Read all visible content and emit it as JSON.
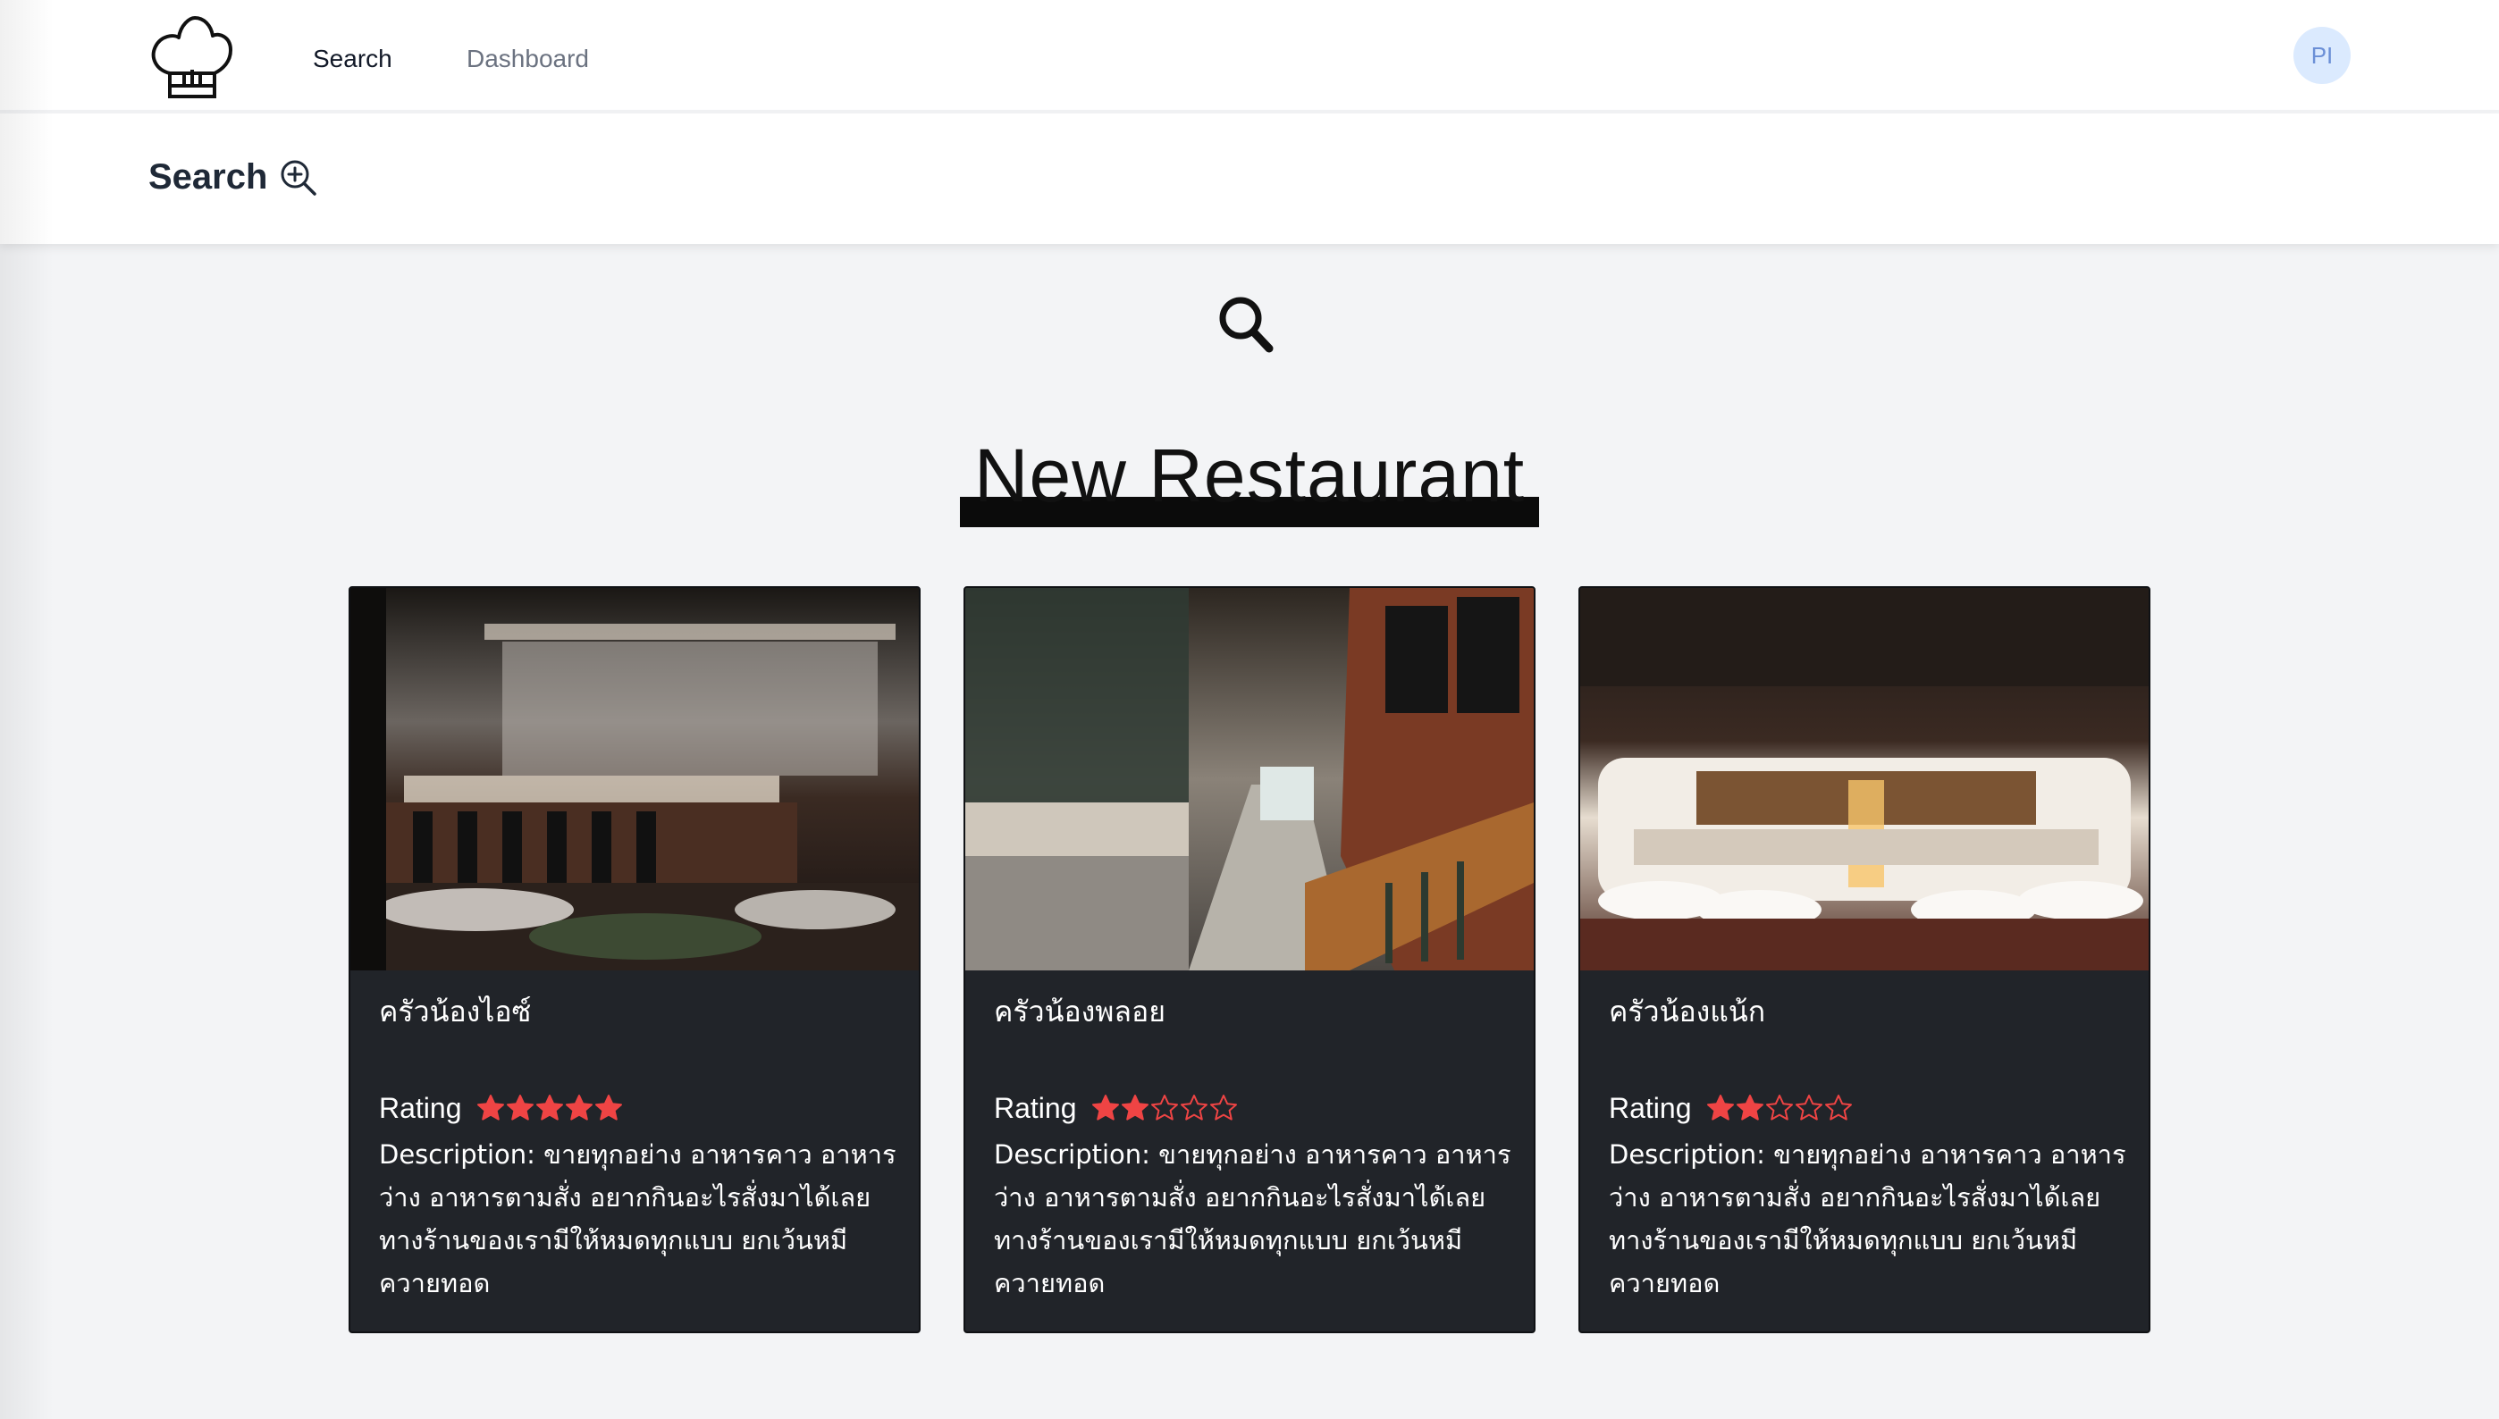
{
  "nav": {
    "logo_icon": "chef-hat-icon",
    "links": [
      {
        "label": "Search"
      },
      {
        "label": "Dashboard"
      }
    ],
    "avatar_initials": "PI"
  },
  "header": {
    "title": "Search",
    "title_icon": "zoom-in-icon"
  },
  "main": {
    "search_icon": "search-icon",
    "section_title": "New Restaurant",
    "rating_label": "Rating",
    "star_color": "#ef4444",
    "cards": [
      {
        "name": "ครัวน้องไอซ์",
        "rating": 5,
        "max_rating": 5,
        "description": "Description: ขายทุกอย่าง อาหารคาว อาหารว่าง อาหารตามสั่ง อยากกินอะไรสั่งมาได้เลย ทางร้านของเรามีให้หมดทุกแบบ ยกเว้นหมีควายทอด"
      },
      {
        "name": "ครัวน้องพลอย",
        "rating": 2,
        "max_rating": 5,
        "description": "Description: ขายทุกอย่าง อาหารคาว อาหารว่าง อาหารตามสั่ง อยากกินอะไรสั่งมาได้เลย ทางร้านของเรามีให้หมดทุกแบบ ยกเว้นหมีควายทอด"
      },
      {
        "name": "ครัวน้องแน้ก",
        "rating": 2,
        "max_rating": 5,
        "description": "Description: ขายทุกอย่าง อาหารคาว อาหารว่าง อาหารตามสั่ง อยากกินอะไรสั่งมาได้เลย ทางร้านของเรามีให้หมดทุกแบบ ยกเว้นหมีควายทอด"
      }
    ]
  }
}
